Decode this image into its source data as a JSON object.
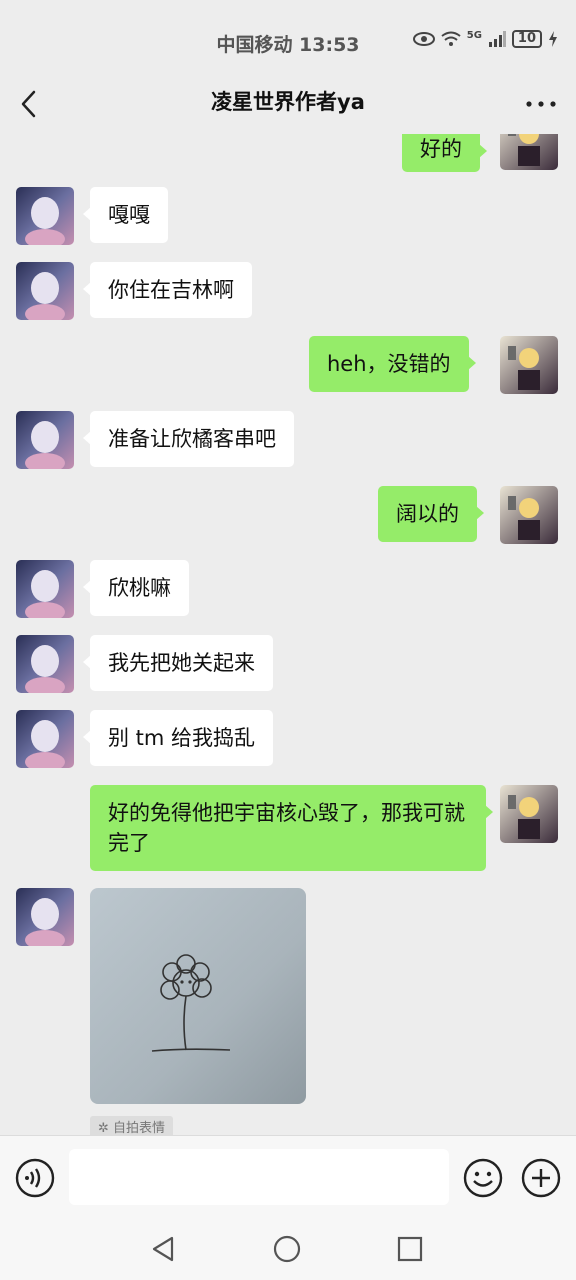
{
  "status_bar": {
    "carrier_time": "中国移动 13:53",
    "network": "5G",
    "battery": "10"
  },
  "header": {
    "title": "凌星世界作者ya",
    "back_icon": "chevron-left-icon",
    "more_icon": "more-dots-icon"
  },
  "messages": [
    {
      "side": "right",
      "text": "好的"
    },
    {
      "side": "left",
      "text": "嘎嘎"
    },
    {
      "side": "left",
      "text": "你住在吉林啊"
    },
    {
      "side": "right",
      "text": "heh，没错的"
    },
    {
      "side": "left",
      "text": "准备让欣橘客串吧"
    },
    {
      "side": "right",
      "text": "阔以的"
    },
    {
      "side": "left",
      "text": "欣桃嘛"
    },
    {
      "side": "left",
      "text": "我先把她关起来"
    },
    {
      "side": "left",
      "text": "别 tm 给我捣乱"
    },
    {
      "side": "right",
      "text": "好的免得他把宇宙核心毁了，那我可就完了"
    },
    {
      "side": "left",
      "type": "image",
      "description": "flower sketch sticker"
    }
  ],
  "sticker_tag": "自拍表情",
  "input_bar": {
    "voice_icon": "voice-icon",
    "emoji_icon": "emoji-icon",
    "plus_icon": "plus-icon"
  },
  "nav": {
    "back": "nav-back-icon",
    "home": "nav-home-icon",
    "recents": "nav-recents-icon"
  },
  "colors": {
    "background": "#ededed",
    "self_bubble": "#95ec69",
    "other_bubble": "#ffffff"
  }
}
